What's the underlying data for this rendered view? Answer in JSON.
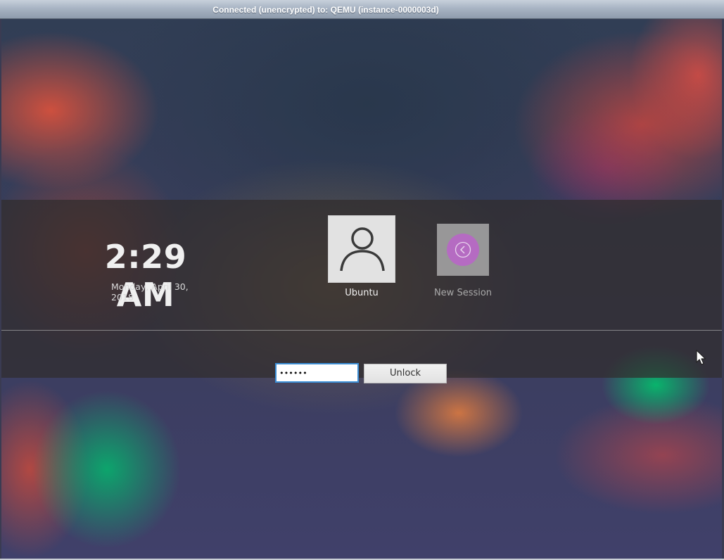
{
  "window": {
    "title": "Connected (unencrypted) to: QEMU (instance-0000003d)"
  },
  "lockscreen": {
    "time": "2:29 AM",
    "date": "Monday, April 30, 2018",
    "user": {
      "name": "Ubuntu",
      "avatar_icon": "user-avatar-icon"
    },
    "new_session": {
      "label": "New Session",
      "icon": "back-arrow-icon",
      "accent_color": "#b56bc2"
    },
    "password": {
      "value": "••••••",
      "focus_color": "#3d8fd6"
    },
    "unlock_label": "Unlock"
  }
}
